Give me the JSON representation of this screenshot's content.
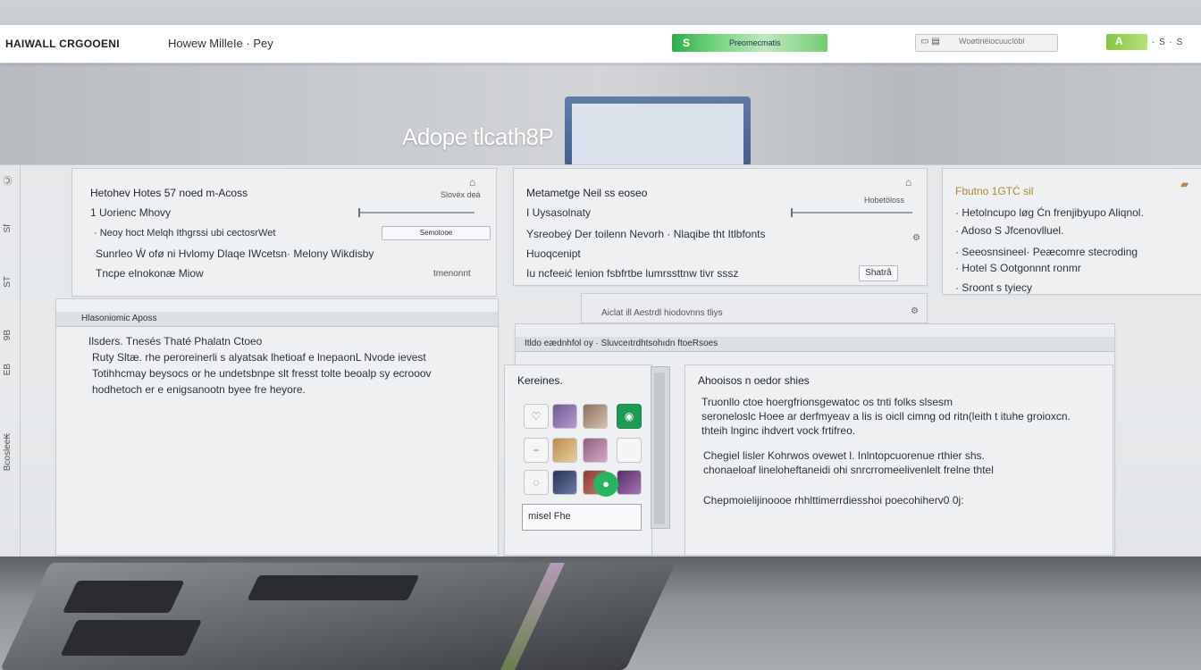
{
  "app": {
    "brand": "HAIWALL CRGOOENI",
    "nav": "Howew MilleIe · Pey"
  },
  "topbar": {
    "green_tick": "S",
    "green_label": "Preomecmatis",
    "search_placeholder": "Woøtiriéiocuuclöbl",
    "status_label": "A",
    "status_tail": "· S · S"
  },
  "hero": {
    "title": "Adope tlcath8P"
  },
  "left_rail": [
    "Ⓒ",
    "Sf",
    "ST",
    "9B",
    "EB",
    "Bcoslee₭"
  ],
  "panel1": {
    "title": "Hetohev Hotes 57 noed m-Acoss",
    "row1": "1 Uorienc Mhovy",
    "row2": "· Neoy hoct Melqh Ithgrssi ubi cectosrWet",
    "row3": "Sunrleo Ẃ ofø ni Hvlomy Dlaqe IWcetsn· Melony Wikdisby",
    "row4": "Tncpe elnokonæ Miow",
    "meta": "Slovéx deá",
    "meta_btn": "Semotooe",
    "tail": "tmenonnt"
  },
  "panel2": {
    "title": "Metametge Neil ss eoseo",
    "row1": "I Uysasolnaty",
    "row2": "Ysreobeý Der toilenn Nevorh · Nlaqibe tht Itlbfonts",
    "row3": "Huoqcenipt",
    "row4": "Iu ncfeeić lenion fsbfrtbe lumrssttnw tivr sssz",
    "meta": "Hobetöloss",
    "meta_btn": "Shatrâ",
    "sub": "Aiclat ill Aestrdl hiodovnns tliys"
  },
  "panel3": {
    "title": "Fbutno 1GTĆ sil",
    "row1": "· Hetolncupo løg Ćn frenjibyupo Aliqnol.",
    "row2": "· Adoso S Jfcenovlluel.",
    "row3": "· Seeosnsineel· Peæcomre stecroding",
    "row4": "· Hotel S Ootgonnnt ronmr",
    "row5": "· Sroont s tyiecy"
  },
  "panel4": {
    "section": "Hlasoniomic Aposs",
    "title": "Ilsders. Tnesés Thaté Phalatn Ctoeo",
    "line1": "Ruty Sltæ. rhe peroreinerli s alyatsak lhetioaf e lnepaonL Nvode ievest",
    "line2": "Totihhcmay beysocs or he undetsbnpe slt fresst tolte beoalp sy ecrooov",
    "line3": "hodhetoch er e enigsanootn byee fre heyore."
  },
  "panel5": {
    "section": "Itldo eædnhfol oy · Sluvceıtrdhtsohıdn ftoeRsoes",
    "gallery_title": "Kereines.",
    "search_value": "misel Fhe",
    "detail_title": "Ahooisos n oedor shies",
    "d1": "Truonllo ctoe hoergfrionsgewatoc os tnti folks slsesm",
    "d2": "seroneloslc Hoee ar derfmyeav a lis is oicll cimng od ritn(leith t ituhe groioxcn.",
    "d3": "thteih lnginc ihdvert vock frtifreo.",
    "d4": "Chegiel lisler Kohrwos ovewet l. Inlntopcuorenue rthier shs.",
    "d5": "chonaeloaf lineloheftaneidi ohi snrcrromeelivenlelt frelne thtel",
    "d6": "Chepmoielijinoooe rhhlttimerrdiesshoi poecohiherv0 0j:"
  },
  "colors": {
    "accent_green": "#2fae4c",
    "lime": "#87c442"
  }
}
